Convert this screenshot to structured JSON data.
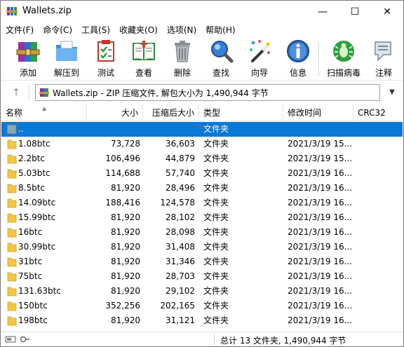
{
  "window": {
    "title": "Wallets.zip",
    "minimize": "—",
    "maximize": "☐",
    "close": "✕"
  },
  "menu": [
    "文件(F)",
    "命令(C)",
    "工具(S)",
    "收藏夹(O)",
    "选项(N)",
    "帮助(H)"
  ],
  "toolbar": {
    "add": "添加",
    "extract": "解压到",
    "test": "测试",
    "view": "查看",
    "delete": "删除",
    "find": "查找",
    "wizard": "向导",
    "info": "信息",
    "virus": "扫描病毒",
    "comment": "注释"
  },
  "address": {
    "text": "Wallets.zip - ZIP 压缩文件, 解包大小为 1,490,944 字节",
    "up": "🡑",
    "dropdown": "▼"
  },
  "columns": {
    "name": "名称",
    "size": "大小",
    "packed": "压缩后大小",
    "type": "类型",
    "modified": "修改时间",
    "crc": "CRC32"
  },
  "rows": [
    {
      "name": "..",
      "size": "",
      "packed": "",
      "type": "文件夹",
      "modified": "",
      "crc": ""
    },
    {
      "name": "1.08btc",
      "size": "73,728",
      "packed": "36,603",
      "type": "文件夹",
      "modified": "2021/3/19 15...",
      "crc": ""
    },
    {
      "name": "2.2btc",
      "size": "106,496",
      "packed": "44,879",
      "type": "文件夹",
      "modified": "2021/3/19 15...",
      "crc": ""
    },
    {
      "name": "5.03btc",
      "size": "114,688",
      "packed": "57,740",
      "type": "文件夹",
      "modified": "2021/3/19 16...",
      "crc": ""
    },
    {
      "name": "8.5btc",
      "size": "81,920",
      "packed": "28,496",
      "type": "文件夹",
      "modified": "2021/3/19 16...",
      "crc": ""
    },
    {
      "name": "14.09btc",
      "size": "188,416",
      "packed": "124,578",
      "type": "文件夹",
      "modified": "2021/3/19 16...",
      "crc": ""
    },
    {
      "name": "15.99btc",
      "size": "81,920",
      "packed": "28,102",
      "type": "文件夹",
      "modified": "2021/3/19 16...",
      "crc": ""
    },
    {
      "name": "16btc",
      "size": "81,920",
      "packed": "28,098",
      "type": "文件夹",
      "modified": "2021/3/19 16...",
      "crc": ""
    },
    {
      "name": "30.99btc",
      "size": "81,920",
      "packed": "31,408",
      "type": "文件夹",
      "modified": "2021/3/19 16...",
      "crc": ""
    },
    {
      "name": "31btc",
      "size": "81,920",
      "packed": "31,346",
      "type": "文件夹",
      "modified": "2021/3/19 16...",
      "crc": ""
    },
    {
      "name": "75btc",
      "size": "81,920",
      "packed": "28,703",
      "type": "文件夹",
      "modified": "2021/3/19 16...",
      "crc": ""
    },
    {
      "name": "131.63btc",
      "size": "81,920",
      "packed": "29,102",
      "type": "文件夹",
      "modified": "2021/3/19 16...",
      "crc": ""
    },
    {
      "name": "150btc",
      "size": "352,256",
      "packed": "202,165",
      "type": "文件夹",
      "modified": "2021/3/19 16...",
      "crc": ""
    },
    {
      "name": "198btc",
      "size": "81,920",
      "packed": "31,121",
      "type": "文件夹",
      "modified": "2021/3/19 16...",
      "crc": ""
    }
  ],
  "status": {
    "text": "总计 13 文件夹, 1,490,944 字节"
  },
  "colors": {
    "selection": "#0a78d7",
    "folder": "#f4c542"
  }
}
